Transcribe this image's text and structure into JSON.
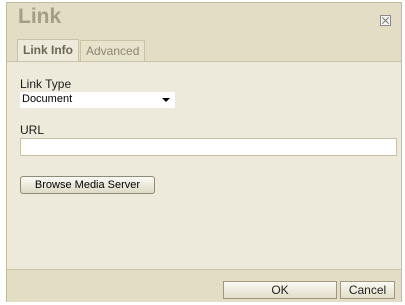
{
  "dialog": {
    "title": "Link",
    "close_icon": "close-icon"
  },
  "tabs": [
    {
      "label": "Link Info",
      "active": true
    },
    {
      "label": "Advanced",
      "active": false
    }
  ],
  "form": {
    "link_type_label": "Link Type",
    "link_type_value": "Document",
    "url_label": "URL",
    "url_value": "",
    "browse_label": "Browse Media Server"
  },
  "footer": {
    "ok_label": "OK",
    "cancel_label": "Cancel"
  },
  "colors": {
    "title": "#a49e86",
    "panel_bg": "#eeeadb",
    "header_bg": "#e2ddc4"
  }
}
